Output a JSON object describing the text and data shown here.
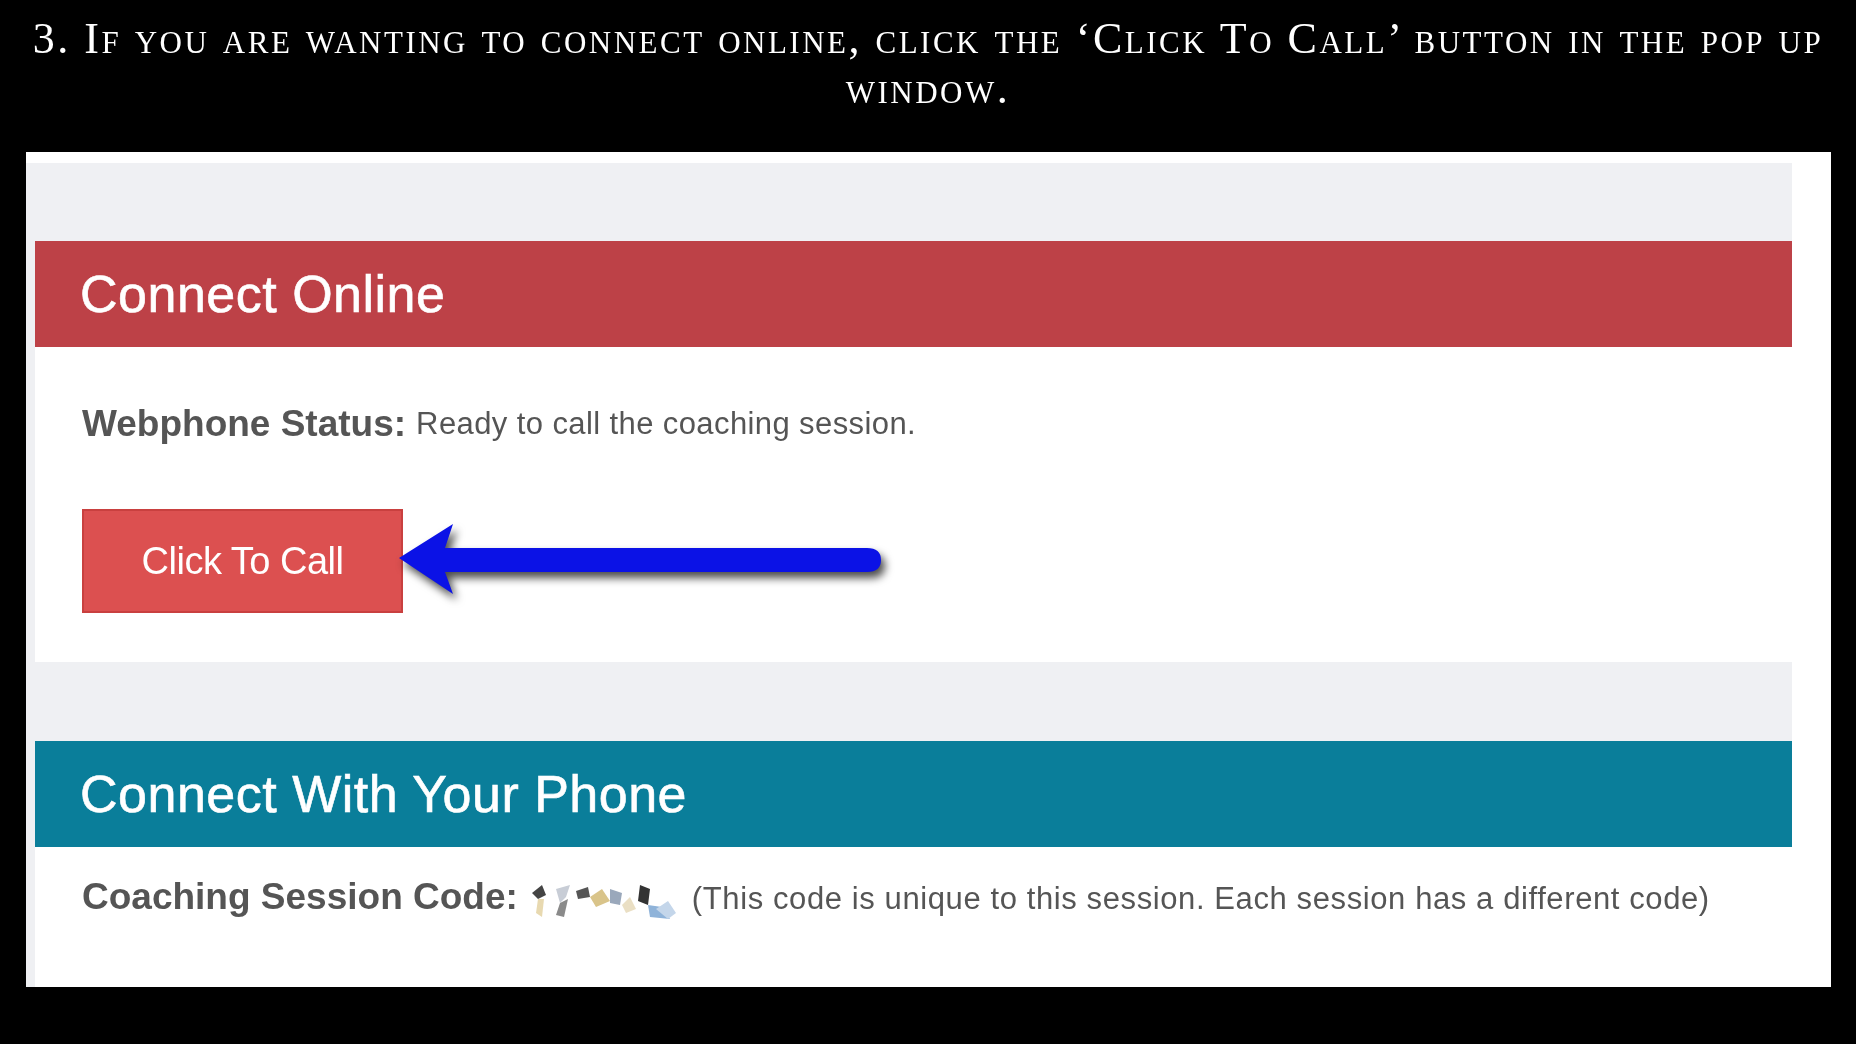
{
  "caption": "3. If you are wanting to connect online, click the ‘Click To Call’ button in the pop up window.",
  "sections": [
    {
      "kind": "online",
      "title": "Connect Online",
      "color": "#bd4147",
      "status_label": "Webphone Status:",
      "status_text": "Ready to call the coaching session.",
      "button": "Click To Call"
    },
    {
      "kind": "phone",
      "title": "Connect With Your Phone",
      "color": "#0a7e9a",
      "code_label": "Coaching Session Code:",
      "note": "(This code is unique to this session. Each session has a different code)"
    }
  ]
}
